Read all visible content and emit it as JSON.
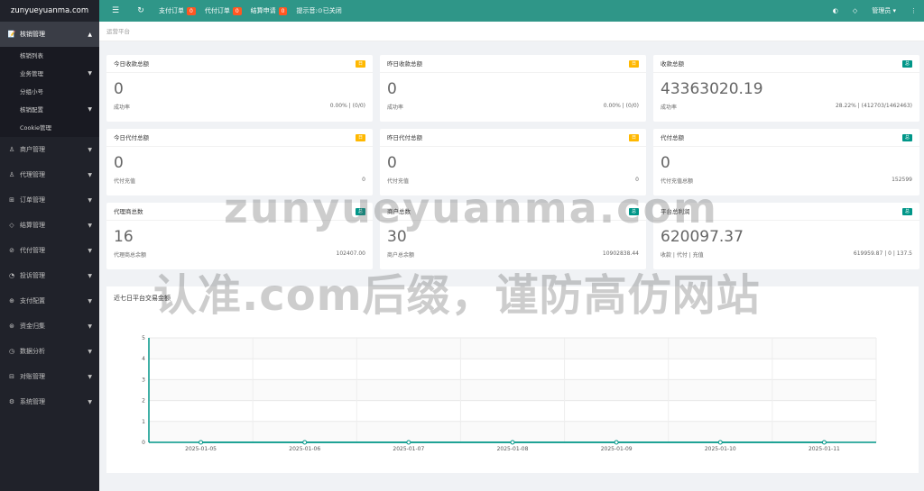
{
  "sidebar": {
    "logo": "zunyueyuanma.com",
    "items": [
      {
        "label": "核销管理",
        "icon": "📝",
        "expanded": true,
        "sub": [
          {
            "label": "核销列表",
            "has_arrow": false
          },
          {
            "label": "业务管理",
            "has_arrow": true
          },
          {
            "label": "分组小号",
            "has_arrow": false
          },
          {
            "label": "核销配置",
            "has_arrow": true
          },
          {
            "label": "Cookie管理",
            "has_arrow": false
          }
        ]
      },
      {
        "label": "商户管理",
        "icon": "♙"
      },
      {
        "label": "代理管理",
        "icon": "♙"
      },
      {
        "label": "订单管理",
        "icon": "⊞"
      },
      {
        "label": "结算管理",
        "icon": "◇"
      },
      {
        "label": "代付管理",
        "icon": "⊘"
      },
      {
        "label": "投诉管理",
        "icon": "◔"
      },
      {
        "label": "支付配置",
        "icon": "⊕"
      },
      {
        "label": "资金归集",
        "icon": "⊛"
      },
      {
        "label": "数据分析",
        "icon": "◷"
      },
      {
        "label": "对账管理",
        "icon": "⊟"
      },
      {
        "label": "系统管理",
        "icon": "⚙"
      }
    ]
  },
  "topbar": {
    "menu_icon": "☰",
    "refresh_icon": "↻",
    "links": [
      {
        "label": "支付订单",
        "count": "0"
      },
      {
        "label": "代付订单",
        "count": "0"
      },
      {
        "label": "结算申请",
        "count": "0"
      }
    ],
    "tip_label": "提示音:",
    "tip_state": "⊙已关闭",
    "theme_icon": "◐",
    "tag_icon": "◇",
    "user": "管理员 ▾",
    "more_icon": "⋮"
  },
  "breadcrumb": "运营平台",
  "cards": [
    {
      "title": "今日收款总额",
      "tag": "日",
      "tag_color": "#ffb800",
      "value": "0",
      "foot_left": "成功率",
      "foot_right": "0.00% | (0/0)"
    },
    {
      "title": "昨日收款总额",
      "tag": "日",
      "tag_color": "#ffb800",
      "value": "0",
      "foot_left": "成功率",
      "foot_right": "0.00% | (0/0)"
    },
    {
      "title": "收款总额",
      "tag": "总",
      "tag_color": "#009688",
      "value": "43363020.19",
      "foot_left": "成功率",
      "foot_right": "28.22% | (412703/1462463)"
    },
    {
      "title": "今日代付总额",
      "tag": "日",
      "tag_color": "#ffb800",
      "value": "0",
      "foot_left": "代付充值",
      "foot_right": "0"
    },
    {
      "title": "昨日代付总额",
      "tag": "日",
      "tag_color": "#ffb800",
      "value": "0",
      "foot_left": "代付充值",
      "foot_right": "0"
    },
    {
      "title": "代付总额",
      "tag": "总",
      "tag_color": "#009688",
      "value": "0",
      "foot_left": "代付充值总额",
      "foot_right": "152599"
    },
    {
      "title": "代理商总数",
      "tag": "总",
      "tag_color": "#009688",
      "value": "16",
      "foot_left": "代理商总余额",
      "foot_right": "102407.00"
    },
    {
      "title": "商户总数",
      "tag": "总",
      "tag_color": "#009688",
      "value": "30",
      "foot_left": "商户总余额",
      "foot_right": "10902838.44"
    },
    {
      "title": "平台总利润",
      "tag": "总",
      "tag_color": "#009688",
      "value": "620097.37",
      "foot_left": "收款 | 代付 | 充值",
      "foot_right": "619959.87 | 0 | 137.5"
    }
  ],
  "watermark": {
    "line1": "zunyueyuanma.com",
    "line2": "认准.com后缀，谨防高仿网站"
  },
  "chart_data": {
    "type": "line",
    "title": "近七日平台交易金额",
    "x": [
      "2025-01-05",
      "2025-01-06",
      "2025-01-07",
      "2025-01-08",
      "2025-01-09",
      "2025-01-10",
      "2025-01-11"
    ],
    "series": [
      {
        "values": [
          0,
          0,
          0,
          0,
          0,
          0,
          0
        ],
        "color": "#009688"
      }
    ],
    "ylim": [
      0,
      5
    ],
    "yticks": [
      0,
      1,
      2,
      3,
      4,
      5
    ],
    "grid": true
  }
}
